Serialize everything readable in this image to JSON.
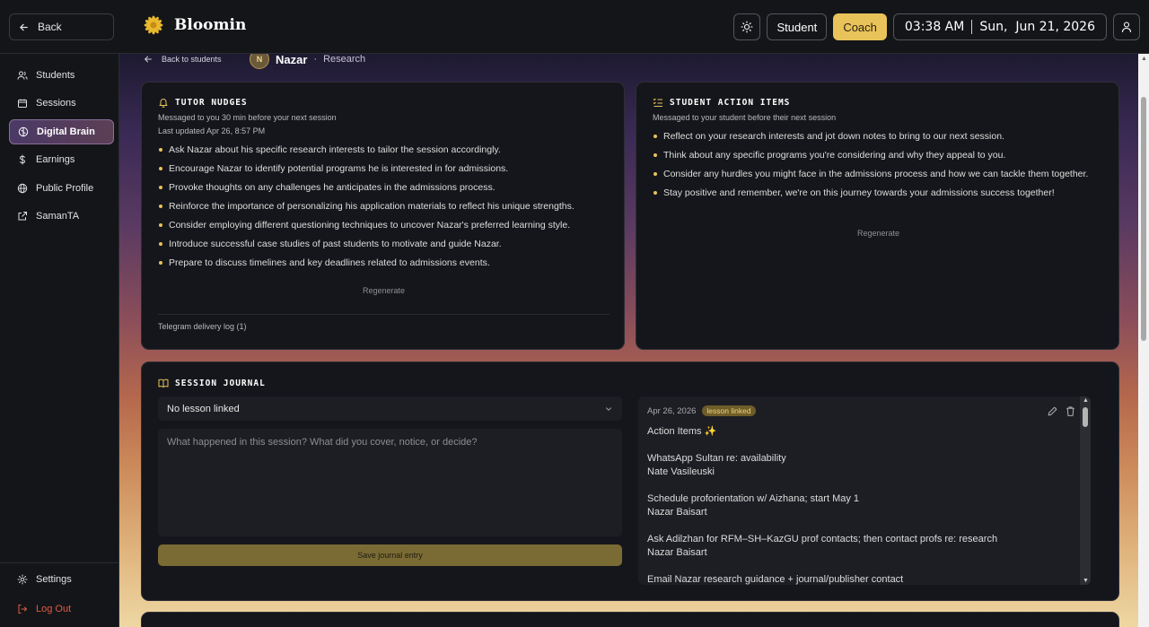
{
  "topbar": {
    "back_label": "Back",
    "brand": "Bloomin",
    "student_label": "Student",
    "coach_label": "Coach",
    "time": "03:38 AM",
    "date": "Sun,  Jun 21, 2026"
  },
  "sidebar": {
    "items": [
      {
        "label": "Students",
        "icon": "users-icon"
      },
      {
        "label": "Sessions",
        "icon": "calendar-icon"
      },
      {
        "label": "Digital Brain",
        "icon": "brain-icon"
      },
      {
        "label": "Earnings",
        "icon": "dollar-icon"
      },
      {
        "label": "Public Profile",
        "icon": "globe-icon"
      },
      {
        "label": "SamanTA",
        "icon": "external-link-icon"
      }
    ],
    "settings_label": "Settings",
    "logout_label": "Log Out"
  },
  "breadcrumb": {
    "back_label": "Back to students",
    "avatar_initial": "N",
    "student_name": "Nazar",
    "separator": "·",
    "topic": "Research"
  },
  "tutor_nudges": {
    "title": "TUTOR NUDGES",
    "subtitle": "Messaged to you 30 min before your next session",
    "updated": "Last updated Apr 26, 8:57 PM",
    "items": [
      "Ask Nazar about his specific research interests to tailor the session accordingly.",
      "Encourage Nazar to identify potential programs he is interested in for admissions.",
      "Provoke thoughts on any challenges he anticipates in the admissions process.",
      "Reinforce the importance of personalizing his application materials to reflect his unique strengths.",
      "Consider employing different questioning techniques to uncover Nazar's preferred learning style.",
      "Introduce successful case studies of past students to motivate and guide Nazar.",
      "Prepare to discuss timelines and key deadlines related to admissions events."
    ],
    "regenerate": "Regenerate",
    "log_label": "Telegram delivery log (1)"
  },
  "student_actions": {
    "title": "STUDENT ACTION ITEMS",
    "subtitle": "Messaged to your student before their next session",
    "items": [
      "Reflect on your research interests and jot down notes to bring to our next session.",
      "Think about any specific programs you're considering and why they appeal to you.",
      "Consider any hurdles you might face in the admissions process and how we can tackle them together.",
      "Stay positive and remember, we're on this journey towards your admissions success together!"
    ],
    "regenerate": "Regenerate"
  },
  "journal": {
    "title": "SESSION JOURNAL",
    "lesson_select": "No lesson linked",
    "placeholder": "What happened in this session? What did you cover, notice, or decide?",
    "save_label": "Save journal entry",
    "entry": {
      "date": "Apr 26, 2026",
      "badge": "lesson linked",
      "heading": "Action Items ✨",
      "blocks": [
        [
          "WhatsApp Sultan re: availability",
          "Nate Vasileuski"
        ],
        [
          "Schedule proforientation w/ Aizhana; start May 1",
          "Nazar Baisart"
        ],
        [
          "Ask Adilzhan for RFM–SH–KazGU prof contacts; then contact profs re: research",
          "Nazar Baisart"
        ],
        [
          "Email Nazar research guidance + journal/publisher contact",
          ""
        ]
      ]
    }
  },
  "colors": {
    "accent": "#e8c35a",
    "danger": "#e05a43",
    "card": "#15161b"
  }
}
